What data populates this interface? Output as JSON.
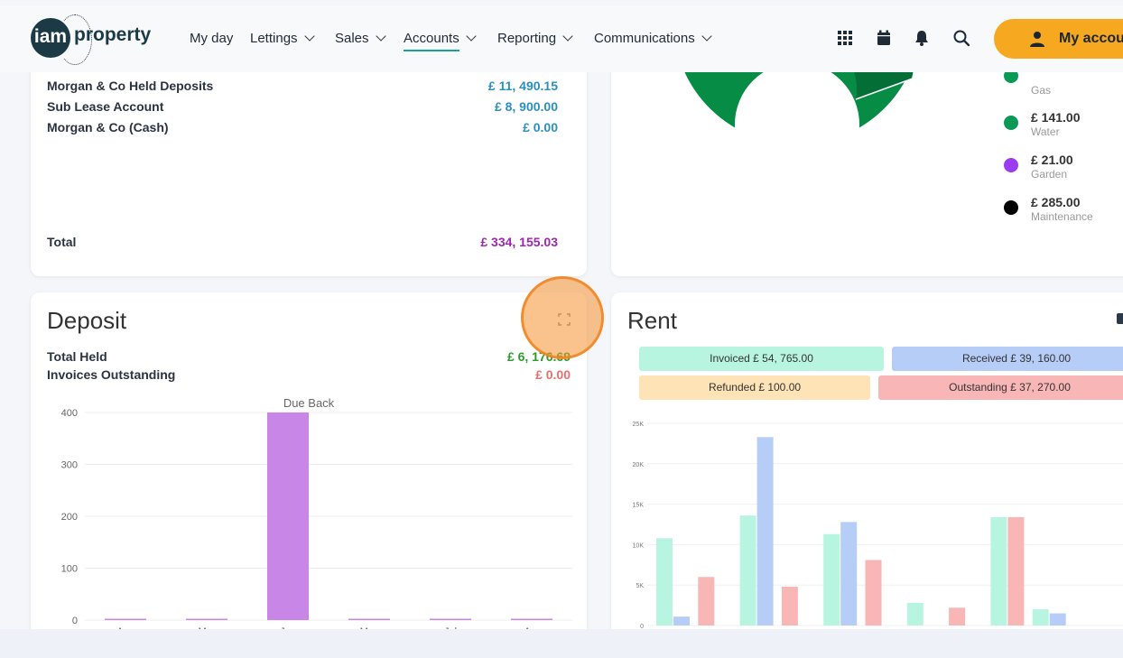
{
  "nav": {
    "brand": "property",
    "brand_icon_text": "iam",
    "items": [
      {
        "label": "My day",
        "has_menu": false,
        "active": false
      },
      {
        "label": "Lettings",
        "has_menu": true,
        "active": false
      },
      {
        "label": "Sales",
        "has_menu": true,
        "active": false
      },
      {
        "label": "Accounts",
        "has_menu": true,
        "active": true
      },
      {
        "label": "Reporting",
        "has_menu": true,
        "active": false
      },
      {
        "label": "Communications",
        "has_menu": true,
        "active": false
      }
    ],
    "icons": [
      "grid-icon",
      "calendar-icon",
      "bell-icon",
      "search-icon"
    ],
    "account_label": "My accou"
  },
  "accounts_card": {
    "rows": [
      {
        "label": "Morgan & Co Held Deposits",
        "value": "£ 11, 490.15"
      },
      {
        "label": "Sub Lease Account",
        "value": "£ 8, 900.00"
      },
      {
        "label": "Morgan & Co (Cash)",
        "value": "£ 0.00"
      }
    ],
    "total_label": "Total",
    "total_value": "£ 334, 155.03"
  },
  "expenses_card": {
    "legend": [
      {
        "amount": "£ 141.00",
        "category": "Water",
        "color": "#0a9a55"
      },
      {
        "amount": "£ 21.00",
        "category": "Garden",
        "color": "#9b3cf0"
      },
      {
        "amount": "£ 285.00",
        "category": "Maintenance",
        "color": "#000000"
      }
    ],
    "partial_legend": {
      "category": "Gas",
      "color": "#0a9a55"
    },
    "donut_colors": {
      "main": "#078c45",
      "secondary": "#036e36"
    }
  },
  "deposit_card": {
    "title": "Deposit",
    "total_held_label": "Total Held",
    "total_held_value": "£ 6, 176.69",
    "invoices_label": "Invoices Outstanding",
    "invoices_value": "£ 0.00",
    "expand_icon": "expand-icon"
  },
  "rent_card": {
    "title": "Rent",
    "pills": [
      {
        "label": "Invoiced £ 54, 765.00",
        "color": "#b8f5e1"
      },
      {
        "label": "Received £ 39, 160.00",
        "color": "#b6cdf7"
      },
      {
        "label": "Refunded £ 100.00",
        "color": "#fde3b5"
      },
      {
        "label": "Outstanding £ 37, 270.00",
        "color": "#f9b6b6"
      }
    ]
  },
  "chart_data": [
    {
      "type": "bar",
      "title": "Due Back",
      "categories": [
        "Aug",
        "Mar",
        "Jun",
        "May",
        "Jul",
        "Apr"
      ],
      "values": [
        0,
        0,
        400,
        0,
        0,
        0
      ],
      "ylim": [
        0,
        400
      ],
      "yticks": [
        0,
        100,
        200,
        300,
        400
      ],
      "color": "#c887e6",
      "grid": true
    },
    {
      "type": "bar",
      "series_colors": [
        "#b8f5e1",
        "#b6cdf7",
        "#f9b6b6"
      ],
      "ylim": [
        0,
        25000
      ],
      "yticks": [
        "0",
        "5K",
        "10K",
        "15K",
        "20K",
        "25K"
      ],
      "groups": [
        {
          "values": [
            10800,
            1100,
            0
          ]
        },
        {
          "values": [
            0,
            0,
            6000
          ]
        },
        {
          "values": [
            13600,
            23300,
            0
          ]
        },
        {
          "values": [
            0,
            0,
            4800
          ]
        },
        {
          "values": [
            11300,
            12800,
            0
          ]
        },
        {
          "values": [
            0,
            0,
            8100
          ]
        },
        {
          "values": [
            2800,
            0,
            0
          ]
        },
        {
          "values": [
            0,
            0,
            2200
          ]
        },
        {
          "values": [
            13400,
            0,
            13400
          ]
        },
        {
          "values": [
            2000,
            1500,
            0
          ]
        }
      ],
      "grid": true
    }
  ]
}
